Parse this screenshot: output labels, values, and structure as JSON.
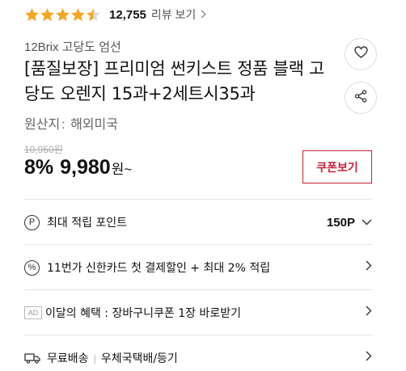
{
  "rating": {
    "stars": 4.5,
    "star_color": "#f5a623",
    "count": "12,755",
    "review_link": "리뷰 보기",
    "chevron_icon": "chevron-right-icon"
  },
  "product": {
    "brand": "12Brix 고당도 엄선",
    "title": "[품질보장] 프리미엄 썬키스트 정품 블랙 고당도 오렌지 15과+2세트시35과",
    "origin_label": "원산지",
    "origin_value": "해외미국"
  },
  "price": {
    "original": "10,950원",
    "discount": "8%",
    "sale": "9,980",
    "currency": "원~",
    "coupon_button": "쿠폰보기",
    "coupon_color": "#c8213a"
  },
  "actions": {
    "heart_icon": "heart-icon",
    "share_icon": "share-icon"
  },
  "benefits": {
    "points": {
      "icon": "P",
      "label": "최대 적립 포인트",
      "value": "150P"
    },
    "card": {
      "icon": "%",
      "label": "11번가 신한카드 첫 결제할인 + 최대 2% 적립"
    },
    "monthly": {
      "badge": "AD",
      "label": "이달의 혜택 : 장바구니쿠폰 1장 바로받기"
    },
    "delivery": {
      "icon": "truck-icon",
      "label": "무료배송",
      "method": "우체국택배/등기"
    }
  }
}
